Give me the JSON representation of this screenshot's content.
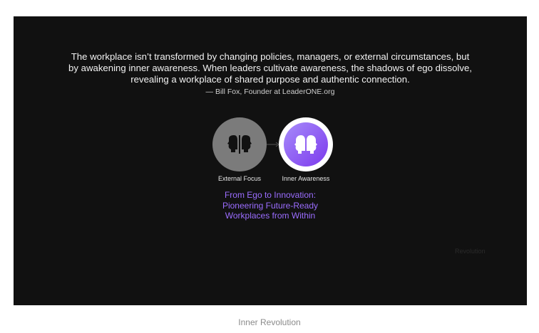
{
  "slide": {
    "quote_lines": [
      "The workplace isn’t transformed by changing policies, managers, or external circumstances, but",
      "by awakening inner awareness. When leaders cultivate awareness, the shadows of ego dissolve,",
      "revealing a workplace of shared purpose and authentic connection."
    ],
    "attribution": "— Bill Fox, Founder at LeaderONE.org",
    "nodes": {
      "external_focus": {
        "label": "External Focus",
        "icon": "two-faces-facing-away-icon"
      },
      "inner_awareness": {
        "label": "Inner Awareness",
        "icon": "two-faces-together-icon"
      }
    },
    "headline_lines": [
      "From Ego to Innovation:",
      "Pioneering Future-Ready",
      "Workplaces from Within"
    ],
    "corner_text": "Revolution",
    "colors": {
      "background": "#111111",
      "accent": "#9b6dff",
      "node_gray": "#7b7b7b"
    }
  },
  "caption": "Inner Revolution"
}
